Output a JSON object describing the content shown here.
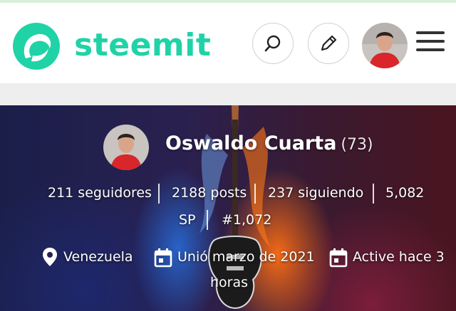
{
  "header": {
    "logo_text": "steemit",
    "brand_color": "#1fd3a7",
    "search_icon": "search-icon",
    "edit_icon": "pencil-icon",
    "menu_icon": "hamburger-icon"
  },
  "profile": {
    "name": "Oswaldo Cuarta",
    "reputation": "(73)",
    "stats": {
      "followers": "211 seguidores",
      "posts": "2188 posts",
      "following": "237 siguiendo",
      "sp_value": "5,082",
      "sp_unit": "SP",
      "rank": "#1,072"
    },
    "meta": {
      "location": "Venezuela",
      "joined": "Unió marzo de 2021",
      "active_line1": "Active hace 3",
      "active_line2": "horas"
    }
  }
}
